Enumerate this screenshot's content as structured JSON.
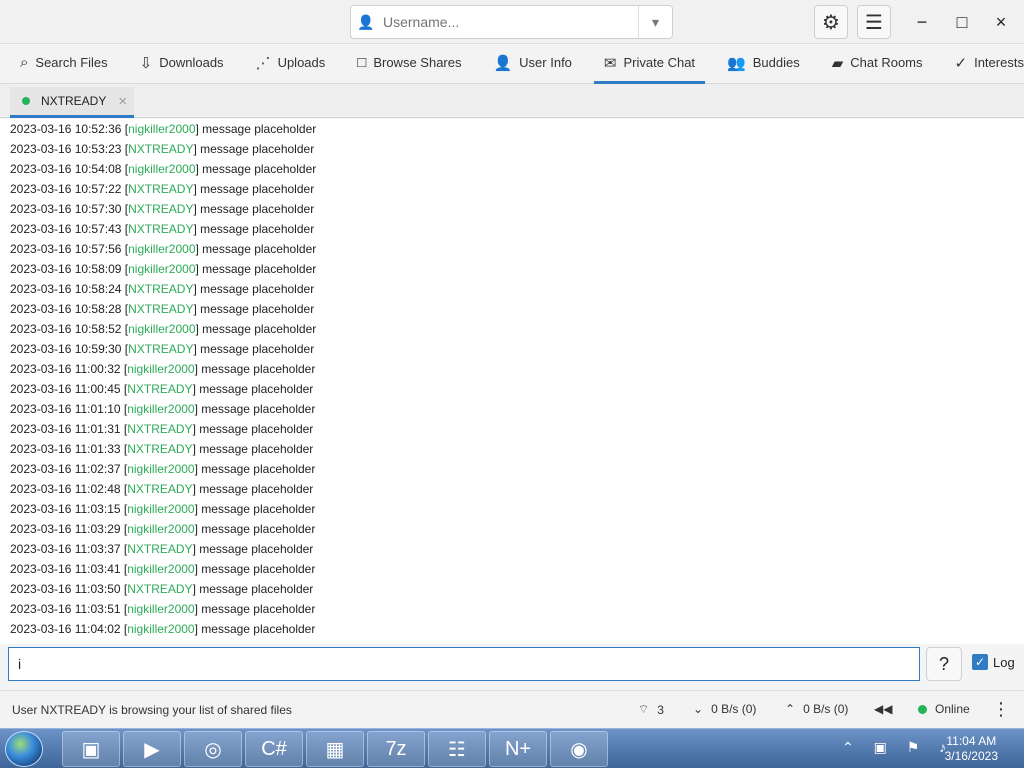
{
  "header": {
    "username_placeholder": "Username..."
  },
  "nav": {
    "items": [
      {
        "label": "Search Files",
        "icon": "search-icon"
      },
      {
        "label": "Downloads",
        "icon": "download-icon"
      },
      {
        "label": "Uploads",
        "icon": "share-icon"
      },
      {
        "label": "Browse Shares",
        "icon": "folder-icon"
      },
      {
        "label": "User Info",
        "icon": "user-icon"
      },
      {
        "label": "Private Chat",
        "icon": "mail-icon",
        "active": true
      },
      {
        "label": "Buddies",
        "icon": "buddies-icon"
      },
      {
        "label": "Chat Rooms",
        "icon": "chat-icon"
      },
      {
        "label": "Interests",
        "icon": "check-icon"
      }
    ]
  },
  "chat_tab": {
    "label": "NXTREADY",
    "status_color": "#22b35b"
  },
  "messages": [
    {
      "time": "2023-03-16 10:52:36",
      "user": "nigkiller2000",
      "text": "message placeholder"
    },
    {
      "time": "2023-03-16 10:53:23",
      "user": "NXTREADY",
      "text": "message placeholder"
    },
    {
      "time": "2023-03-16 10:54:08",
      "user": "nigkiller2000",
      "text": "message placeholder"
    },
    {
      "time": "2023-03-16 10:57:22",
      "user": "NXTREADY",
      "text": "message placeholder"
    },
    {
      "time": "2023-03-16 10:57:30",
      "user": "NXTREADY",
      "text": "message placeholder"
    },
    {
      "time": "2023-03-16 10:57:43",
      "user": "NXTREADY",
      "text": "message placeholder"
    },
    {
      "time": "2023-03-16 10:57:56",
      "user": "nigkiller2000",
      "text": "message placeholder"
    },
    {
      "time": "2023-03-16 10:58:09",
      "user": "nigkiller2000",
      "text": "message placeholder"
    },
    {
      "time": "2023-03-16 10:58:24",
      "user": "NXTREADY",
      "text": "message placeholder"
    },
    {
      "time": "2023-03-16 10:58:28",
      "user": "NXTREADY",
      "text": "message placeholder"
    },
    {
      "time": "2023-03-16 10:58:52",
      "user": "nigkiller2000",
      "text": "message placeholder"
    },
    {
      "time": "2023-03-16 10:59:30",
      "user": "NXTREADY",
      "text": "message placeholder"
    },
    {
      "time": "2023-03-16 11:00:32",
      "user": "nigkiller2000",
      "text": "message placeholder"
    },
    {
      "time": "2023-03-16 11:00:45",
      "user": "NXTREADY",
      "text": "message placeholder"
    },
    {
      "time": "2023-03-16 11:01:10",
      "user": "nigkiller2000",
      "text": "message placeholder"
    },
    {
      "time": "2023-03-16 11:01:31",
      "user": "NXTREADY",
      "text": "message placeholder"
    },
    {
      "time": "2023-03-16 11:01:33",
      "user": "NXTREADY",
      "text": "message placeholder"
    },
    {
      "time": "2023-03-16 11:02:37",
      "user": "nigkiller2000",
      "text": "message placeholder"
    },
    {
      "time": "2023-03-16 11:02:48",
      "user": "NXTREADY",
      "text": "message placeholder"
    },
    {
      "time": "2023-03-16 11:03:15",
      "user": "nigkiller2000",
      "text": "message placeholder"
    },
    {
      "time": "2023-03-16 11:03:29",
      "user": "nigkiller2000",
      "text": "message placeholder"
    },
    {
      "time": "2023-03-16 11:03:37",
      "user": "NXTREADY",
      "text": "message placeholder"
    },
    {
      "time": "2023-03-16 11:03:41",
      "user": "nigkiller2000",
      "text": "message placeholder"
    },
    {
      "time": "2023-03-16 11:03:50",
      "user": "NXTREADY",
      "text": "message placeholder"
    },
    {
      "time": "2023-03-16 11:03:51",
      "user": "nigkiller2000",
      "text": "message placeholder"
    },
    {
      "time": "2023-03-16 11:04:02",
      "user": "nigkiller2000",
      "text": "message placeholder"
    }
  ],
  "composer": {
    "value": "i",
    "help": "?",
    "log_label": "Log",
    "log_checked": true
  },
  "status": {
    "text": "User NXTREADY is browsing your list of shared files",
    "connections": "3",
    "download": "0 B/s (0)",
    "upload": "0 B/s (0)",
    "online": "Online"
  },
  "taskbar": {
    "time": "11:04 AM",
    "date": "3/16/2023"
  }
}
